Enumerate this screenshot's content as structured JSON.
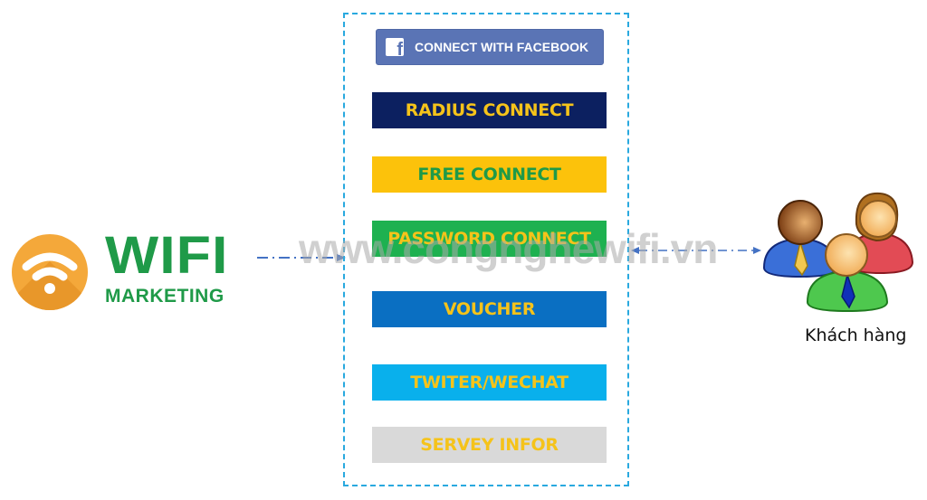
{
  "logo": {
    "icon": "wifi-icon",
    "title": "WIFI",
    "subtitle": "MARKETING",
    "circle_color": "#f4a83a",
    "text_color": "#1f9a48"
  },
  "login_panel": {
    "border_color": "#29a9df",
    "facebook_button": {
      "icon": "facebook-icon",
      "label": "CONNECT WITH FACEBOOK",
      "bg": "#5a74b5"
    },
    "options": [
      {
        "label": "RADIUS CONNECT",
        "bg": "#0c2060",
        "fg": "#f5c31a"
      },
      {
        "label": "FREE CONNECT",
        "bg": "#fcc20b",
        "fg": "#1f9a48"
      },
      {
        "label": "PASSWORD CONNECT",
        "bg": "#1eb150",
        "fg": "#f5c31a"
      },
      {
        "label": "VOUCHER",
        "bg": "#0a6fc2",
        "fg": "#f5c31a"
      },
      {
        "label": "TWITER/WECHAT",
        "bg": "#09b0ec",
        "fg": "#f5c31a"
      },
      {
        "label": "SERVEY INFOR",
        "bg": "#d9d9d9",
        "fg": "#f5c31a"
      }
    ]
  },
  "watermark": "www.congnghewifi.vn",
  "customers": {
    "icon": "users-group-icon",
    "label": "Khách hàng"
  },
  "connectors": {
    "color": "#4472c4"
  }
}
